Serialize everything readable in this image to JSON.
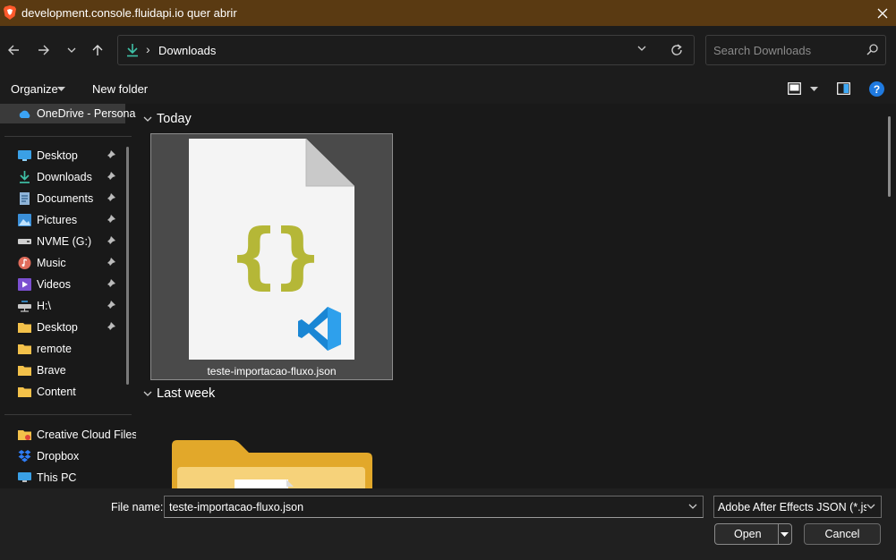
{
  "window": {
    "title": "development.console.fluidapi.io quer abrir",
    "brand_color": "#ff5a2c",
    "titlebar_color": "#5a3a12"
  },
  "nav": {
    "back_icon": "arrow-left-icon",
    "forward_icon": "arrow-right-icon",
    "recent_icon": "chevron-down-icon",
    "up_icon": "arrow-up-icon",
    "address_path": "Downloads",
    "search_placeholder": "Search Downloads"
  },
  "commandbar": {
    "organize_label": "Organize",
    "new_folder_label": "New folder",
    "help_label": "?"
  },
  "sidebar": {
    "onedrive": "OneDrive - Personal",
    "quick_access": [
      {
        "label": "Desktop",
        "icon": "desktop-icon",
        "pinned": true
      },
      {
        "label": "Downloads",
        "icon": "download-icon",
        "pinned": true
      },
      {
        "label": "Documents",
        "icon": "documents-icon",
        "pinned": true
      },
      {
        "label": "Pictures",
        "icon": "pictures-icon",
        "pinned": true
      },
      {
        "label": "NVME (G:)",
        "icon": "drive-icon",
        "pinned": true
      },
      {
        "label": "Music",
        "icon": "music-icon",
        "pinned": true
      },
      {
        "label": "Videos",
        "icon": "videos-icon",
        "pinned": true
      },
      {
        "label": "H:\\",
        "icon": "network-drive-icon",
        "pinned": true
      },
      {
        "label": "Desktop",
        "icon": "folder-icon",
        "pinned": true
      },
      {
        "label": "remote",
        "icon": "folder-icon",
        "pinned": false
      },
      {
        "label": "Brave",
        "icon": "folder-icon",
        "pinned": false
      },
      {
        "label": "Content",
        "icon": "folder-icon",
        "pinned": false
      }
    ],
    "other": [
      {
        "label": "Creative Cloud Files",
        "icon": "creative-cloud-icon"
      },
      {
        "label": "Dropbox",
        "icon": "dropbox-icon"
      },
      {
        "label": "This PC",
        "icon": "this-pc-icon"
      }
    ]
  },
  "main": {
    "groups": [
      {
        "label": "Today",
        "files": [
          {
            "name": "teste-importacao-fluxo.json",
            "icon": "vscode-json-file-icon",
            "selected": true
          }
        ]
      },
      {
        "label": "Last week",
        "files": [
          {
            "name": "",
            "icon": "folder-icon"
          }
        ]
      }
    ]
  },
  "footer": {
    "file_name_label": "File name:",
    "file_name_value": "teste-importacao-fluxo.json",
    "file_type_value": "Adobe After Effects JSON (*.json)",
    "open_label": "Open",
    "cancel_label": "Cancel"
  }
}
